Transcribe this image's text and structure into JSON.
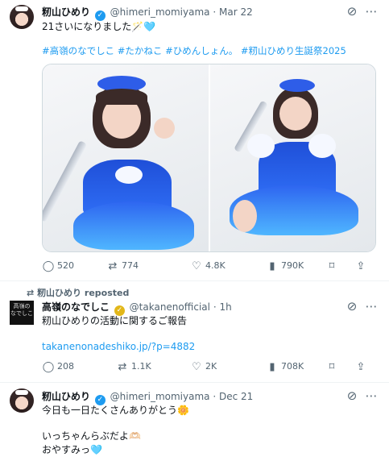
{
  "tweet1": {
    "name": "籾山ひめり",
    "handle": "@himeri_momiyama",
    "dot": "·",
    "date": "Mar 22",
    "text": "21さいになりました🪄🩵",
    "hashtags": "#高嶺のなでしこ #たかねこ #ひめんしょん。 #籾山ひめり生誕祭2025",
    "metrics": {
      "replies": "520",
      "reposts": "774",
      "likes": "4.8K",
      "views": "790K"
    }
  },
  "repost": {
    "label": "籾山ひめり reposted"
  },
  "tweet2": {
    "name": "高嶺のなでしこ",
    "handle": "@takanenofficial",
    "dot": "·",
    "date": "1h",
    "avatar_text": "高嶺の なでしこ",
    "text": "籾山ひめりの活動に関するご報告",
    "link": "takanenonadeshiko.jp/?p=4882",
    "metrics": {
      "replies": "208",
      "reposts": "1.1K",
      "likes": "2K",
      "views": "708K"
    }
  },
  "tweet3": {
    "name": "籾山ひめり",
    "handle": "@himeri_momiyama",
    "dot": "·",
    "date": "Dec 21",
    "line1": "今日も一日たくさんありがとう🌼",
    "line2": "いっちゃんらぶだよ🫶🏻",
    "line3": "おやすみっ🩵"
  },
  "icons": {
    "grok": "⊘",
    "more": "⋯",
    "reply": "◯",
    "repost": "⇄",
    "like": "♡",
    "views": "▮",
    "bookmark": "⌑",
    "share": "⇪",
    "verified": "✓"
  },
  "colors": {
    "link": "#1d9bf0",
    "muted": "#536471",
    "verified_blue": "#1d9bf0",
    "verified_gold": "#e2b719"
  }
}
